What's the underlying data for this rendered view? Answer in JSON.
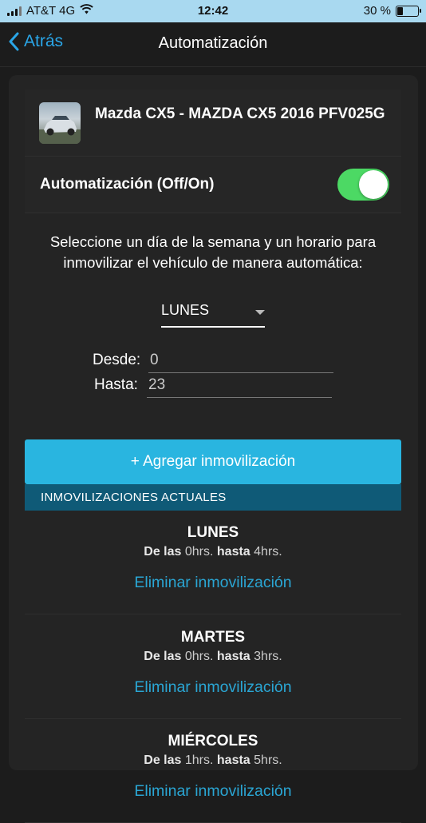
{
  "status_bar": {
    "carrier": "AT&T 4G",
    "time": "12:42",
    "battery": "30 %",
    "battery_level": 0.3
  },
  "nav": {
    "back_label": "Atrás",
    "title": "Automatización"
  },
  "vehicle": {
    "name": "Mazda CX5 - MAZDA CX5 2016 PFV025G"
  },
  "automation": {
    "label": "Automatización (Off/On)",
    "enabled": true,
    "toggle_color": "#4cd964"
  },
  "form": {
    "instruction": "Seleccione un día de la semana y un horario para inmovilizar el vehículo de manera automática:",
    "selected_day": "LUNES",
    "from_label": "Desde:",
    "from_value": "0",
    "to_label": "Hasta:",
    "to_value": "23",
    "add_button": "+ Agregar inmovilización"
  },
  "current": {
    "header": "INMOVILIZACIONES ACTUALES",
    "items": [
      {
        "day": "LUNES",
        "de_las": "De las",
        "from": "0hrs.",
        "hasta": "hasta",
        "to": "4hrs.",
        "delete_label": "Eliminar inmovilización"
      },
      {
        "day": "MARTES",
        "de_las": "De las",
        "from": "0hrs.",
        "hasta": "hasta",
        "to": "3hrs.",
        "delete_label": "Eliminar inmovilización"
      },
      {
        "day": "MIÉRCOLES",
        "de_las": "De las",
        "from": "1hrs.",
        "hasta": "hasta",
        "to": "5hrs.",
        "delete_label": "Eliminar inmovilización"
      }
    ]
  },
  "colors": {
    "accent": "#29b5e0",
    "link": "#2aa6d4",
    "section_header": "#0f5a77"
  }
}
